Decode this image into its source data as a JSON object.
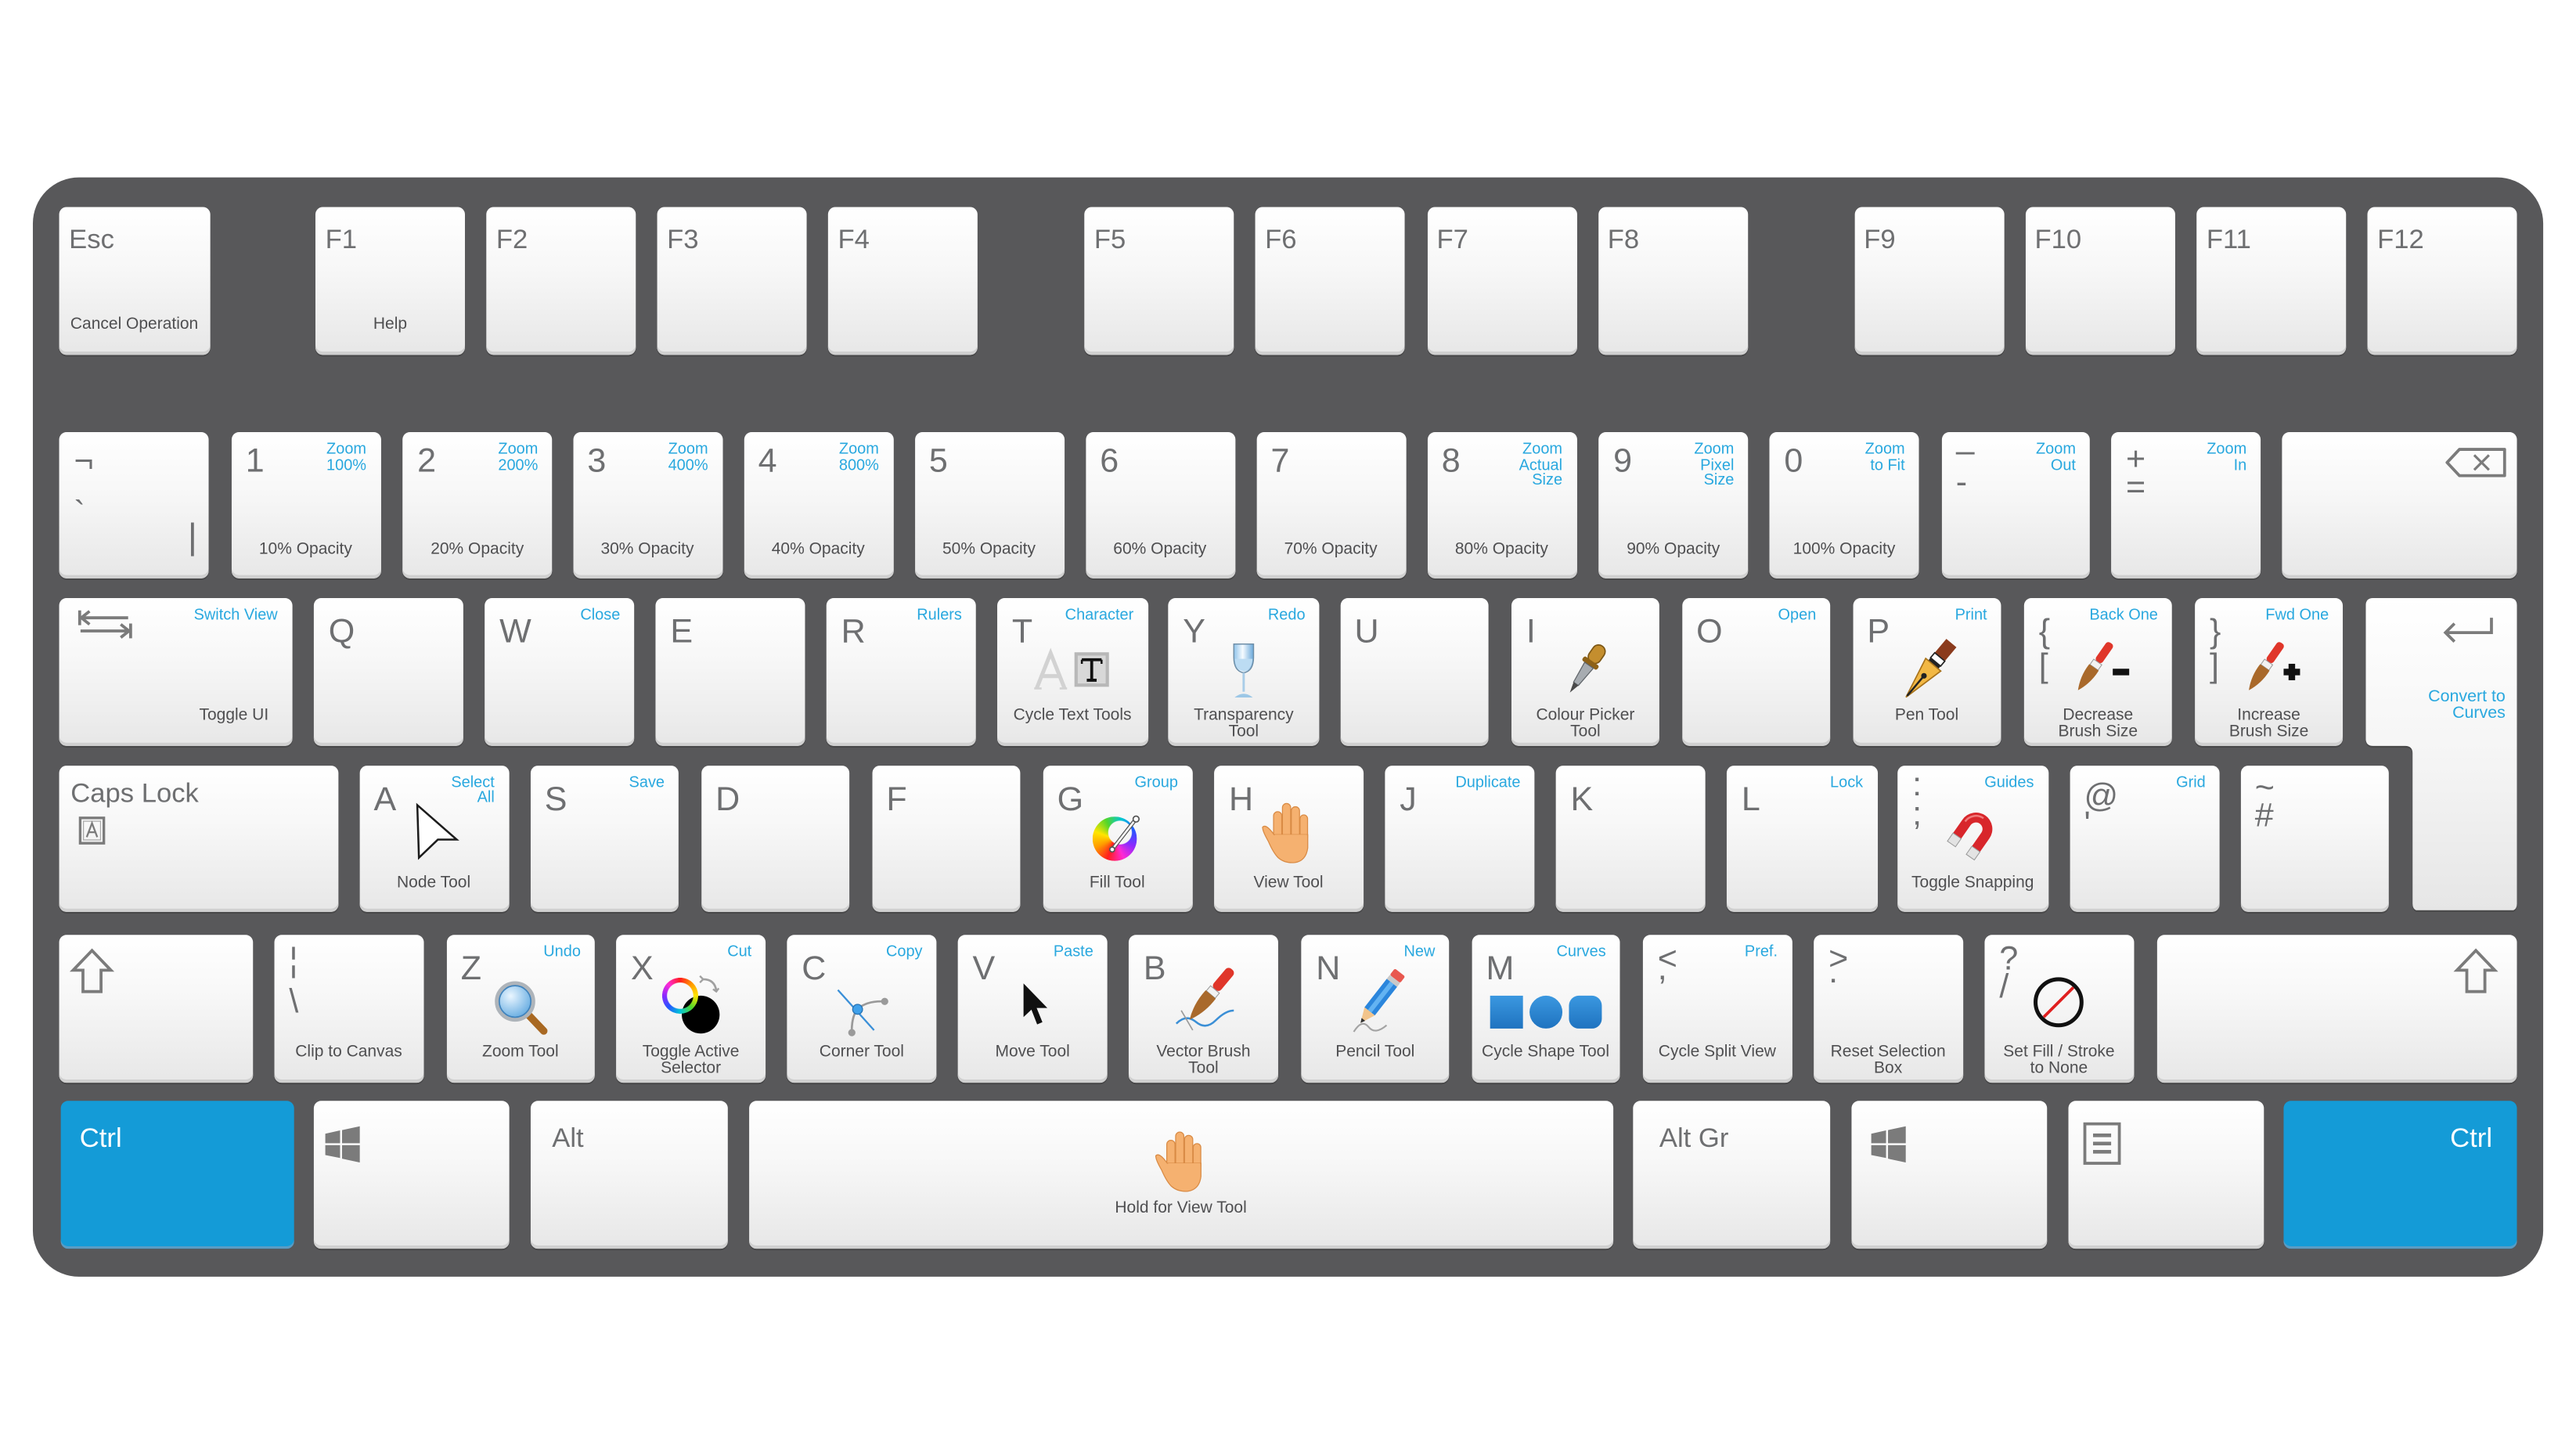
{
  "theme": {
    "keyboard_body_color": "#58585a",
    "glyph_color": "#6e6f71",
    "label_color": "#4f4f51",
    "shortcut_color": "#29a8df",
    "modifier_key_color": "#149bd7",
    "modifier_text_color": "#ffffff"
  },
  "rows": [
    {
      "name": "function-row",
      "keys": [
        {
          "id": "esc",
          "glyph": "Esc",
          "action": "Cancel Operation"
        },
        {
          "id": "f1",
          "glyph": "F1",
          "action": "Help"
        },
        {
          "id": "f2",
          "glyph": "F2"
        },
        {
          "id": "f3",
          "glyph": "F3"
        },
        {
          "id": "f4",
          "glyph": "F4"
        },
        {
          "id": "f5",
          "glyph": "F5"
        },
        {
          "id": "f6",
          "glyph": "F6"
        },
        {
          "id": "f7",
          "glyph": "F7"
        },
        {
          "id": "f8",
          "glyph": "F8"
        },
        {
          "id": "f9",
          "glyph": "F9"
        },
        {
          "id": "f10",
          "glyph": "F10"
        },
        {
          "id": "f11",
          "glyph": "F11"
        },
        {
          "id": "f12",
          "glyph": "F12"
        }
      ]
    },
    {
      "name": "number-row",
      "keys": [
        {
          "id": "backtick",
          "glyph": "¬",
          "glyph_lower": "`",
          "glyph_alt": "|"
        },
        {
          "id": "1",
          "glyph": "1",
          "shortcut": "Zoom\n100%",
          "action": "10% Opacity"
        },
        {
          "id": "2",
          "glyph": "2",
          "shortcut": "Zoom\n200%",
          "action": "20% Opacity"
        },
        {
          "id": "3",
          "glyph": "3",
          "shortcut": "Zoom\n400%",
          "action": "30% Opacity"
        },
        {
          "id": "4",
          "glyph": "4",
          "shortcut": "Zoom\n800%",
          "action": "40% Opacity"
        },
        {
          "id": "5",
          "glyph": "5",
          "action": "50% Opacity"
        },
        {
          "id": "6",
          "glyph": "6",
          "action": "60% Opacity"
        },
        {
          "id": "7",
          "glyph": "7",
          "action": "70% Opacity"
        },
        {
          "id": "8",
          "glyph": "8",
          "shortcut": "Zoom\nActual\nSize",
          "action": "80% Opacity"
        },
        {
          "id": "9",
          "glyph": "9",
          "shortcut": "Zoom\nPixel\nSize",
          "action": "90% Opacity"
        },
        {
          "id": "0",
          "glyph": "0",
          "shortcut": "Zoom\nto Fit",
          "action": "100% Opacity"
        },
        {
          "id": "minus",
          "glyph": "–",
          "glyph_lower": "-",
          "shortcut": "Zoom\nOut"
        },
        {
          "id": "equals",
          "glyph": "+",
          "glyph_lower": "=",
          "shortcut": "Zoom\nIn"
        },
        {
          "id": "backspace",
          "icon": "backspace-icon"
        }
      ]
    },
    {
      "name": "top-letter-row",
      "keys": [
        {
          "id": "tab",
          "icon": "tab-icon",
          "shortcut": "Switch View",
          "action": "Toggle UI"
        },
        {
          "id": "q",
          "glyph": "Q"
        },
        {
          "id": "w",
          "glyph": "W",
          "shortcut": "Close"
        },
        {
          "id": "e",
          "glyph": "E"
        },
        {
          "id": "r",
          "glyph": "R",
          "shortcut": "Rulers"
        },
        {
          "id": "t",
          "glyph": "T",
          "shortcut": "Character",
          "icon": "text-tools-icon",
          "action": "Cycle Text Tools"
        },
        {
          "id": "y",
          "glyph": "Y",
          "shortcut": "Redo",
          "icon": "wine-glass-icon",
          "action": "Transparency\nTool"
        },
        {
          "id": "u",
          "glyph": "U"
        },
        {
          "id": "i",
          "glyph": "I",
          "icon": "eyedropper-icon",
          "action": "Colour Picker\nTool"
        },
        {
          "id": "o",
          "glyph": "O",
          "shortcut": "Open"
        },
        {
          "id": "p",
          "glyph": "P",
          "shortcut": "Print",
          "icon": "pen-nib-icon",
          "action": "Pen Tool"
        },
        {
          "id": "left-bracket",
          "glyph": "{",
          "glyph_lower": "[",
          "shortcut": "Back One",
          "icon": "brush-minus-icon",
          "action": "Decrease\nBrush Size"
        },
        {
          "id": "right-bracket",
          "glyph": "}",
          "glyph_lower": "]",
          "shortcut": "Fwd One",
          "icon": "brush-plus-icon",
          "action": "Increase\nBrush Size"
        },
        {
          "id": "enter",
          "icon": "enter-icon",
          "shortcut": "Convert to\nCurves"
        }
      ]
    },
    {
      "name": "home-row",
      "keys": [
        {
          "id": "caps-lock",
          "glyph": "Caps Lock",
          "icon": "caps-lock-icon"
        },
        {
          "id": "a",
          "glyph": "A",
          "shortcut": "Select\nAll",
          "icon": "node-arrow-icon",
          "action": "Node Tool"
        },
        {
          "id": "s",
          "glyph": "S",
          "shortcut": "Save"
        },
        {
          "id": "d",
          "glyph": "D"
        },
        {
          "id": "f",
          "glyph": "F"
        },
        {
          "id": "g",
          "glyph": "G",
          "shortcut": "Group",
          "icon": "colour-wheel-icon",
          "action": "Fill Tool"
        },
        {
          "id": "h",
          "glyph": "H",
          "icon": "hand-icon",
          "action": "View Tool"
        },
        {
          "id": "j",
          "glyph": "J",
          "shortcut": "Duplicate"
        },
        {
          "id": "k",
          "glyph": "K"
        },
        {
          "id": "l",
          "glyph": "L",
          "shortcut": "Lock"
        },
        {
          "id": "semicolon",
          "glyph": ":",
          "glyph_lower": ";",
          "shortcut": "Guides",
          "icon": "magnet-icon",
          "action": "Toggle Snapping"
        },
        {
          "id": "apostrophe",
          "glyph": "@",
          "glyph_lower": "'",
          "shortcut": "Grid"
        },
        {
          "id": "hash",
          "glyph": "~",
          "glyph_lower": "#"
        }
      ]
    },
    {
      "name": "bottom-letter-row",
      "keys": [
        {
          "id": "left-shift",
          "icon": "shift-icon"
        },
        {
          "id": "backslash",
          "glyph": "¦",
          "glyph_lower": "\\",
          "action": "Clip to Canvas"
        },
        {
          "id": "z",
          "glyph": "Z",
          "shortcut": "Undo",
          "icon": "magnifier-icon",
          "action": "Zoom Tool"
        },
        {
          "id": "x",
          "glyph": "X",
          "shortcut": "Cut",
          "icon": "colour-selector-icon",
          "action": "Toggle Active\nSelector"
        },
        {
          "id": "c",
          "glyph": "C",
          "shortcut": "Copy",
          "icon": "corner-node-icon",
          "action": "Corner Tool"
        },
        {
          "id": "v",
          "glyph": "V",
          "shortcut": "Paste",
          "icon": "pointer-arrow-icon",
          "action": "Move Tool"
        },
        {
          "id": "b",
          "glyph": "B",
          "icon": "vector-brush-icon",
          "action": "Vector Brush\nTool"
        },
        {
          "id": "n",
          "glyph": "N",
          "shortcut": "New",
          "icon": "pencil-icon",
          "action": "Pencil Tool"
        },
        {
          "id": "m",
          "glyph": "M",
          "shortcut": "Curves",
          "icon": "shapes-icon",
          "action": "Cycle Shape Tool"
        },
        {
          "id": "comma",
          "glyph": "<",
          "glyph_lower": ",",
          "shortcut": "Pref.",
          "action": "Cycle Split View"
        },
        {
          "id": "period",
          "glyph": ">",
          "glyph_lower": ".",
          "action": "Reset Selection\nBox"
        },
        {
          "id": "slash",
          "glyph": "?",
          "glyph_lower": "/",
          "icon": "none-icon",
          "action": "Set Fill / Stroke\nto None"
        },
        {
          "id": "right-shift",
          "icon": "shift-icon"
        }
      ]
    },
    {
      "name": "modifier-row",
      "keys": [
        {
          "id": "left-ctrl",
          "glyph": "Ctrl"
        },
        {
          "id": "left-windows",
          "icon": "windows-icon"
        },
        {
          "id": "left-alt",
          "glyph": "Alt"
        },
        {
          "id": "space",
          "icon": "hand-icon",
          "action": "Hold for View Tool"
        },
        {
          "id": "alt-gr",
          "glyph": "Alt Gr"
        },
        {
          "id": "right-windows",
          "icon": "windows-icon"
        },
        {
          "id": "menu",
          "icon": "menu-icon"
        },
        {
          "id": "right-ctrl",
          "glyph": "Ctrl"
        }
      ]
    }
  ]
}
